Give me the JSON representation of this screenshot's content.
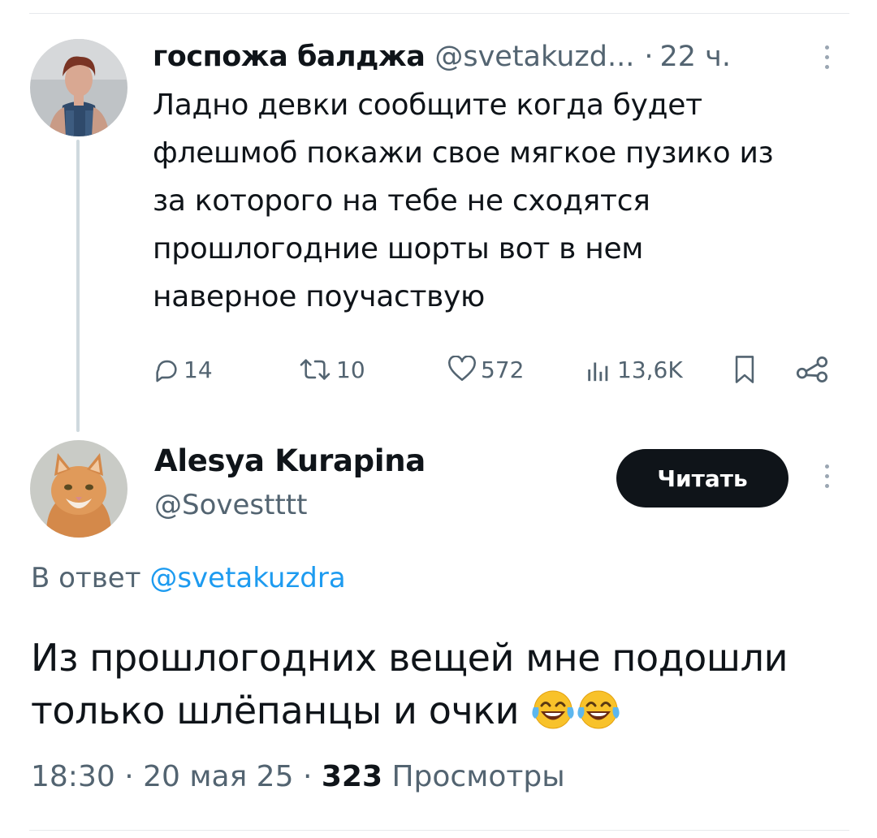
{
  "tweet1": {
    "author_name": "госпожа балджа",
    "author_handle": "@svetakuzd...",
    "separator": "·",
    "time": "22 ч.",
    "text": "Ладно девки сообщите когда будет\nфлешмоб покажи свое мягкое пузико из\nза которого на тебе не сходятся\nпрошлогодние шорты вот в нем\nнаверное поучаствую",
    "stats": {
      "replies": "14",
      "retweets": "10",
      "likes": "572",
      "views": "13,6K"
    }
  },
  "tweet2": {
    "author_name": "Alesya Kurapina",
    "author_handle": "@Sovestttt",
    "follow_label": "Читать",
    "reply_prefix": "В ответ",
    "reply_handle": "@svetakuzdra",
    "text": "Из прошлогодних вещей мне подошли только шлёпанцы и очки",
    "emoji": [
      "face-with-tears-of-joy-icon",
      "face-with-tears-of-joy-icon"
    ],
    "time": "18:30",
    "date": "20 мая 25",
    "views_count": "323",
    "views_label": "Просмотры"
  },
  "colors": {
    "text": "#0f1419",
    "secondary": "#536471",
    "link": "#1d9bf0",
    "button_bg": "#0f1419",
    "thread_line": "#cfd9de"
  }
}
